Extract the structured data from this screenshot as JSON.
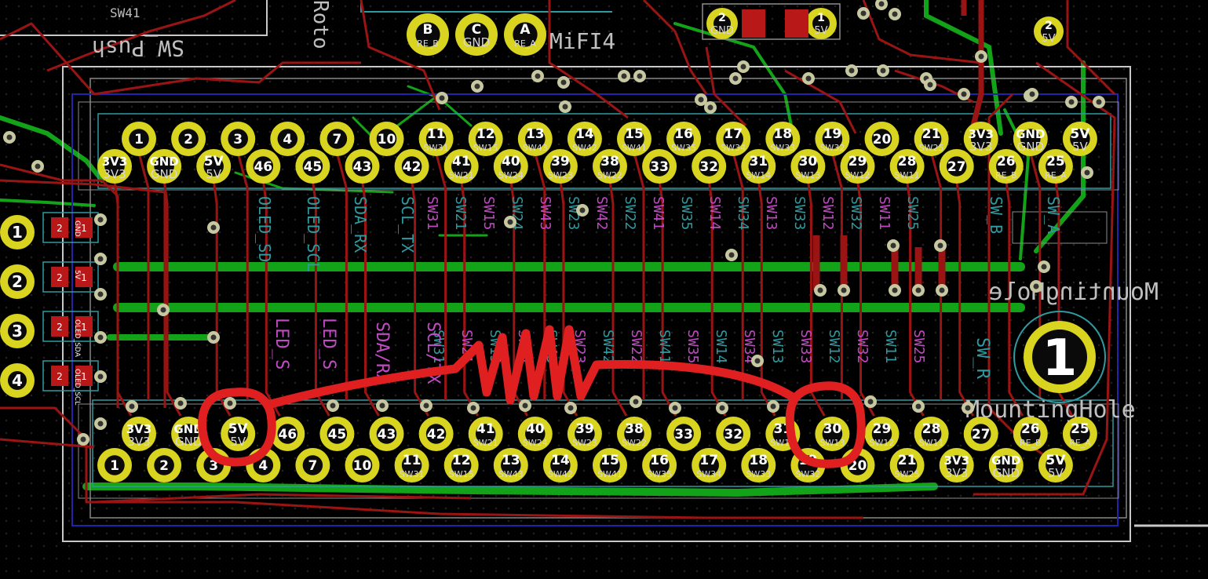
{
  "colors": {
    "background": "#000000",
    "pad": "#d8d420",
    "pad_hole": "#0a0a0a",
    "front_copper": "#9a1414",
    "back_copper": "#13a318",
    "silkscreen": "#c0c0c0",
    "fabrication": "#c24ac4",
    "courtyard": "#2f9aa0",
    "edge_cuts": "#c8c8c8",
    "annotation": "#e02020"
  },
  "top_labels": {
    "rotary_pads": [
      {
        "num": "B",
        "net": "RE_B"
      },
      {
        "num": "C",
        "net": "GND"
      },
      {
        "num": "A",
        "net": "RE_A"
      }
    ],
    "rotary_ref": "MiFI4",
    "rotary_ref2": "Roto",
    "sw_push": "SW_Push",
    "sw41": "SW41",
    "gnd_pad": {
      "num": "2",
      "net": "GND"
    },
    "v5_pad": {
      "num": "1",
      "net": "5V"
    },
    "right_pad": {
      "num": "2",
      "net": "5V"
    }
  },
  "header_top": {
    "row_a": [
      {
        "num": "1",
        "net": ""
      },
      {
        "num": "2",
        "net": ""
      },
      {
        "num": "3",
        "net": ""
      },
      {
        "num": "4",
        "net": ""
      },
      {
        "num": "7",
        "net": ""
      },
      {
        "num": "10",
        "net": ""
      },
      {
        "num": "11",
        "net": "SW31"
      },
      {
        "num": "12",
        "net": "SW15"
      },
      {
        "num": "13",
        "net": "SW43"
      },
      {
        "num": "14",
        "net": "SW42"
      },
      {
        "num": "15",
        "net": "SW41"
      },
      {
        "num": "16",
        "net": "SW35"
      },
      {
        "num": "17",
        "net": "SW34"
      },
      {
        "num": "18",
        "net": "SW33"
      },
      {
        "num": "19",
        "net": "SW32"
      },
      {
        "num": "20",
        "net": ""
      },
      {
        "num": "21",
        "net": "SW25"
      },
      {
        "num": "3V3",
        "net": "3V3"
      },
      {
        "num": "GND",
        "net": "GND"
      },
      {
        "num": "5V",
        "net": "5V"
      }
    ],
    "row_b": [
      {
        "num": "3V3",
        "net": "3V3"
      },
      {
        "num": "GND",
        "net": "GND"
      },
      {
        "num": "5V",
        "net": "5V"
      },
      {
        "num": "46",
        "net": ""
      },
      {
        "num": "45",
        "net": ""
      },
      {
        "num": "43",
        "net": ""
      },
      {
        "num": "42",
        "net": ""
      },
      {
        "num": "41",
        "net": "SW21"
      },
      {
        "num": "40",
        "net": "SW24"
      },
      {
        "num": "39",
        "net": "SW23"
      },
      {
        "num": "38",
        "net": "SW22"
      },
      {
        "num": "33",
        "net": ""
      },
      {
        "num": "32",
        "net": ""
      },
      {
        "num": "31",
        "net": "SW14"
      },
      {
        "num": "30",
        "net": "SW13"
      },
      {
        "num": "29",
        "net": "SW12"
      },
      {
        "num": "28",
        "net": "SW11"
      },
      {
        "num": "27",
        "net": ""
      },
      {
        "num": "26",
        "net": "RE_B"
      },
      {
        "num": "25",
        "net": "RE_A"
      }
    ]
  },
  "header_bottom": {
    "row_a": [
      {
        "num": "3V3",
        "net": "3V3"
      },
      {
        "num": "GND",
        "net": "GND"
      },
      {
        "num": "5V",
        "net": "5V"
      },
      {
        "num": "46",
        "net": ""
      },
      {
        "num": "45",
        "net": ""
      },
      {
        "num": "43",
        "net": ""
      },
      {
        "num": "42",
        "net": ""
      },
      {
        "num": "41",
        "net": "SW21"
      },
      {
        "num": "40",
        "net": "SW24"
      },
      {
        "num": "39",
        "net": "SW23"
      },
      {
        "num": "38",
        "net": "SW22"
      },
      {
        "num": "33",
        "net": ""
      },
      {
        "num": "32",
        "net": ""
      },
      {
        "num": "31",
        "net": "SW14"
      },
      {
        "num": "30",
        "net": "SW13"
      },
      {
        "num": "29",
        "net": "SW12"
      },
      {
        "num": "28",
        "net": "SW11"
      },
      {
        "num": "27",
        "net": ""
      },
      {
        "num": "26",
        "net": "RE_B"
      },
      {
        "num": "25",
        "net": "RE_A"
      }
    ],
    "row_b": [
      {
        "num": "1",
        "net": ""
      },
      {
        "num": "2",
        "net": ""
      },
      {
        "num": "3",
        "net": ""
      },
      {
        "num": "4",
        "net": ""
      },
      {
        "num": "7",
        "net": ""
      },
      {
        "num": "10",
        "net": ""
      },
      {
        "num": "11",
        "net": "SW31"
      },
      {
        "num": "12",
        "net": "SW15"
      },
      {
        "num": "13",
        "net": "SW43"
      },
      {
        "num": "14",
        "net": "SW42"
      },
      {
        "num": "15",
        "net": "SW41"
      },
      {
        "num": "16",
        "net": "SW35"
      },
      {
        "num": "17",
        "net": "SW34"
      },
      {
        "num": "18",
        "net": "SW33"
      },
      {
        "num": "19",
        "net": "SW32"
      },
      {
        "num": "20",
        "net": ""
      },
      {
        "num": "21",
        "net": "SW25"
      },
      {
        "num": "3V3",
        "net": "3V3"
      },
      {
        "num": "GND",
        "net": "GND"
      },
      {
        "num": "5V",
        "net": "5V"
      }
    ]
  },
  "left_pads": [
    "1",
    "2",
    "3",
    "4"
  ],
  "left_resistors": [
    {
      "a": "2",
      "b": "1",
      "net": "GND"
    },
    {
      "a": "2",
      "b": "1",
      "net": "5V"
    },
    {
      "a": "2",
      "b": "1",
      "net": "OLED_SDA"
    },
    {
      "a": "2",
      "b": "1",
      "net": "OLED_SCL"
    }
  ],
  "mounting": {
    "label": "MountingHole",
    "number": "1",
    "sw_label": "SW_R"
  },
  "rotated_labels": [
    "OLED_SD",
    "OLED_SCL",
    "SDA_RX",
    "SCL_TX",
    "SW_B",
    "SW_A"
  ],
  "mid_labels": [
    "LED_S",
    "LED_S",
    "SDA/RX",
    "SCL/TX",
    "SW_R"
  ],
  "fab_columns": [
    "SW31",
    "SW21",
    "SW15",
    "SW24",
    "SW43",
    "SW23",
    "SW42",
    "SW22",
    "SW41",
    "SW35",
    "SW14",
    "SW34",
    "SW13",
    "SW33",
    "SW12",
    "SW32",
    "SW11",
    "SW25"
  ]
}
